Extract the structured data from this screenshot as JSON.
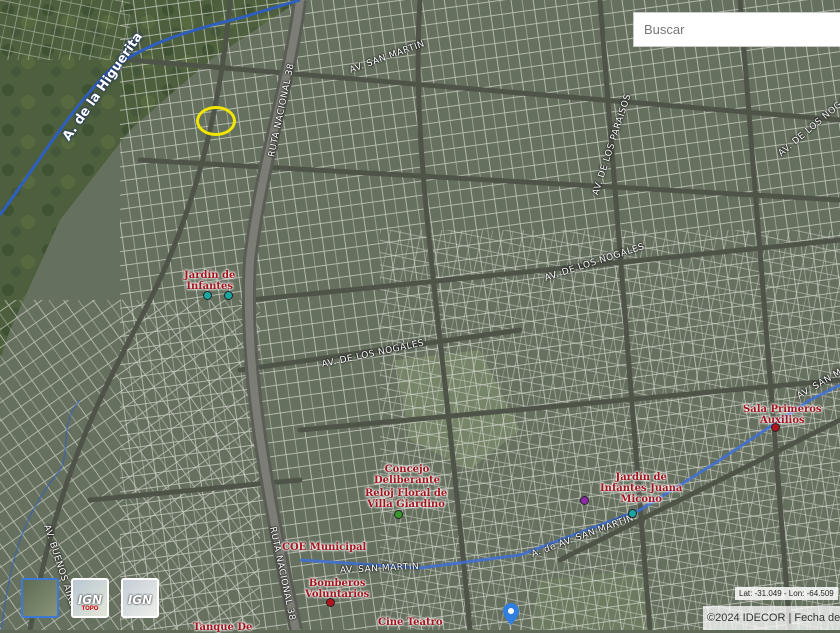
{
  "search": {
    "placeholder": "Buscar"
  },
  "river": {
    "name": "A. de la Higuerita"
  },
  "roads": [
    {
      "id": "ruta-38-north",
      "label": "RUTA NACIONAL 38"
    },
    {
      "id": "ruta-38-south",
      "label": "RUTA NACIONAL 38"
    },
    {
      "id": "san-martin-north",
      "label": "AV. SAN MARTIN"
    },
    {
      "id": "los-paraisos",
      "label": "AV. DE LOS PARAISOS"
    },
    {
      "id": "los-nogales-ne",
      "label": "AV. DE LOS NOGALES"
    },
    {
      "id": "los-nogales-e",
      "label": "AV. DE LOS NOGALES"
    },
    {
      "id": "los-nogales-w",
      "label": "AV. DE LOS NOGALES"
    },
    {
      "id": "san-martin-east",
      "label": "AV. SAN MA"
    },
    {
      "id": "san-martin-center",
      "label": "A. de AV. SAN MARTIN"
    },
    {
      "id": "san-martin-south",
      "label": "AV. SAN MARTIN"
    },
    {
      "id": "los-cerros",
      "label": "AV. BUENOS AIRES"
    }
  ],
  "pois": [
    {
      "id": "jardin-infantes-west",
      "lines": [
        "Jardín de",
        "Infantes"
      ],
      "color": "#1aa6a0"
    },
    {
      "id": "sala-primeros-auxilios",
      "lines": [
        "Sala Primeros",
        "Auxilios"
      ],
      "color": "#b0141c"
    },
    {
      "id": "concejo-deliberante",
      "lines": [
        "Concejo",
        "Deliberante"
      ],
      "color": "#b0141c"
    },
    {
      "id": "reloj-floral",
      "lines": [
        "Reloj Floral de",
        "Villa Giardino"
      ],
      "color": "#3b9a2d"
    },
    {
      "id": "jardin-juana-micono",
      "lines": [
        "Jardín de",
        "Infantes Juana",
        "Micono"
      ],
      "color": "#1aa6a0"
    },
    {
      "id": "coe-municipal",
      "lines": [
        "COE Municipal"
      ],
      "color": "#b0141c"
    },
    {
      "id": "bomberos",
      "lines": [
        "Bomberos",
        "Voluntarios"
      ],
      "color": "#b0141c"
    },
    {
      "id": "cine-teatro",
      "lines": [
        "Cine Teatro"
      ],
      "color": "#b0141c"
    },
    {
      "id": "tanque",
      "lines": [
        "Tanque De"
      ],
      "color": "#b0141c"
    }
  ],
  "coords": {
    "text": "Lat: -31.049 - Lon: -64.509"
  },
  "attribution": {
    "text": "©2024 IDECOR | Fecha de"
  },
  "layers": [
    {
      "id": "satellite",
      "label": "",
      "sub": ""
    },
    {
      "id": "ign-topo",
      "label": "IGN",
      "sub": "TOPO"
    },
    {
      "id": "ign-argenmap",
      "label": "IGN",
      "sub": ""
    }
  ],
  "colors": {
    "river": "#2e5fbf",
    "parcel_line": "#d7dbd2",
    "selection": "#f2e600",
    "poi_text": "#a0141e"
  }
}
